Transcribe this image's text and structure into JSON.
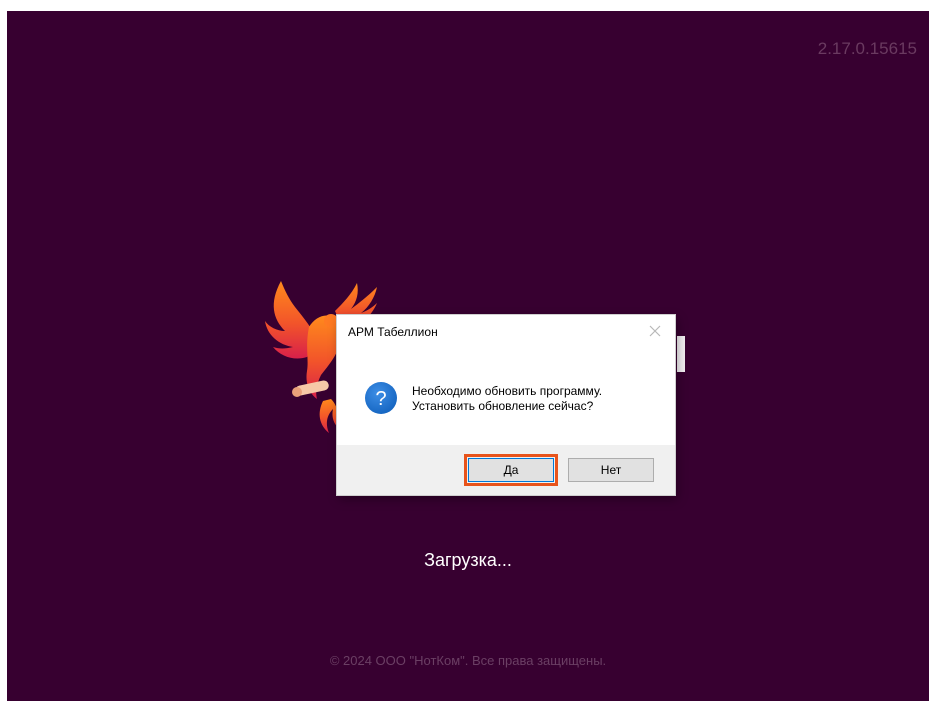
{
  "splash": {
    "version": "2.17.0.15615",
    "loading_text": "Загрузка...",
    "copyright": "© 2024 ООО \"НотКом\". Все права защищены.",
    "background_color": "#370030",
    "logo_icon": "phoenix-logo-icon"
  },
  "dialog": {
    "title": "АРМ Табеллион",
    "close_icon": "close-icon",
    "question_icon": "question-icon",
    "message_line1": "Необходимо обновить программу.",
    "message_line2": "Установить обновление сейчас?",
    "yes_label": "Да",
    "no_label": "Нет",
    "highlight_color": "#e8541c"
  }
}
